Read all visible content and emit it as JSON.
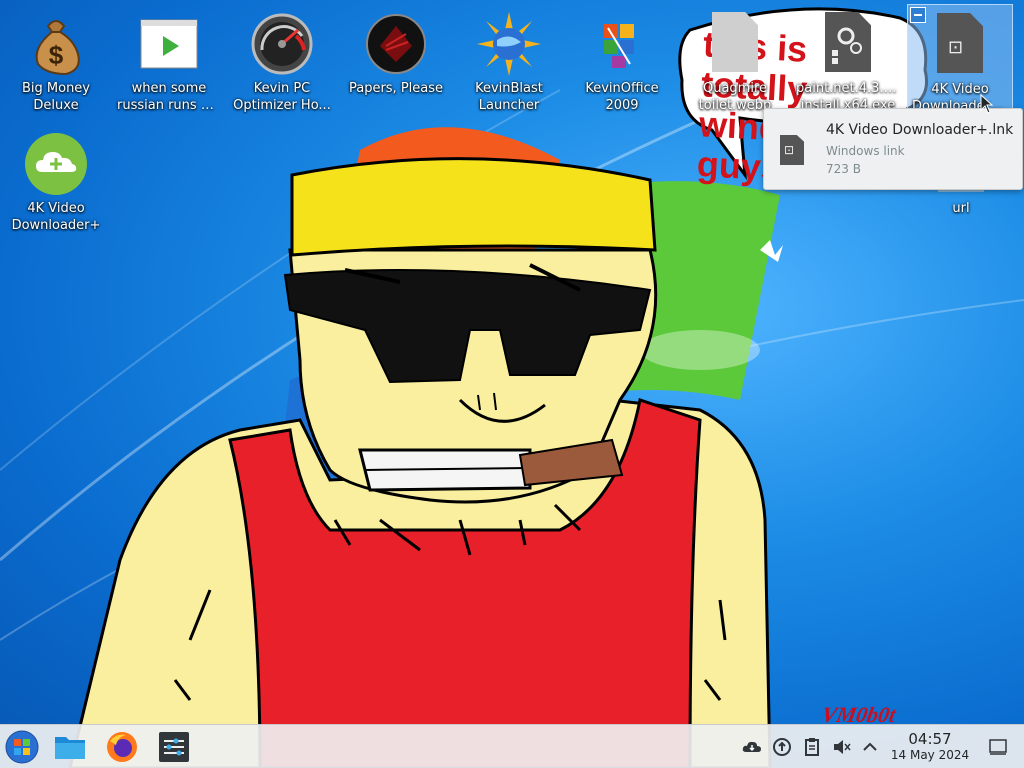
{
  "desktop": {
    "icons": [
      {
        "label_line1": "Big Money",
        "label_line2": "Deluxe",
        "icon": "money-bag-icon"
      },
      {
        "label_line1": "when some",
        "label_line2": "russian runs a...",
        "icon": "video-play-icon"
      },
      {
        "label_line1": "Kevin PC",
        "label_line2": "Optimizer Ho...",
        "icon": "speedometer-icon"
      },
      {
        "label_line1": "Papers, Please",
        "label_line2": "",
        "icon": "papers-please-icon"
      },
      {
        "label_line1": "KevinBlast",
        "label_line2": "Launcher",
        "icon": "sun-globe-icon"
      },
      {
        "label_line1": "KevinOffice",
        "label_line2": "2009",
        "icon": "office-logo-icon"
      },
      {
        "label_line1": "Quagmire",
        "label_line2": "toilet.webp",
        "icon": "image-file-icon"
      },
      {
        "label_line1": "paint.net.4.3.12.",
        "label_line2": "install.x64.exe",
        "icon": "installer-file-icon"
      },
      {
        "label_line1": "4K Video",
        "label_line2": "Downloader+...",
        "icon": "link-file-icon"
      },
      {
        "label_line1": "4K Video",
        "label_line2": "Downloader+",
        "icon": "cloud-download-icon"
      },
      {
        "label_line1": "url",
        "label_line2": "",
        "icon": "url-file-icon"
      }
    ]
  },
  "wallpaper": {
    "speech_bubble_text": "this is totally windows 7 guys",
    "watermark": "VM0b0t"
  },
  "tooltip": {
    "title": "4K Video Downloader+.lnk",
    "type": "Windows link",
    "size": "723 B"
  },
  "taskbar": {
    "time": "04:57",
    "date": "14 May 2024",
    "launchers": [
      "start-menu-icon",
      "file-manager-icon",
      "firefox-icon",
      "settings-mixer-icon"
    ]
  },
  "colors": {
    "desktop_blue": "#1d8de6",
    "taskbar_bg": "#eff0f1",
    "tooltip_bg": "#eff0f1",
    "shirt_red": "#e8202a",
    "headband_yellow": "#f5e21b"
  }
}
